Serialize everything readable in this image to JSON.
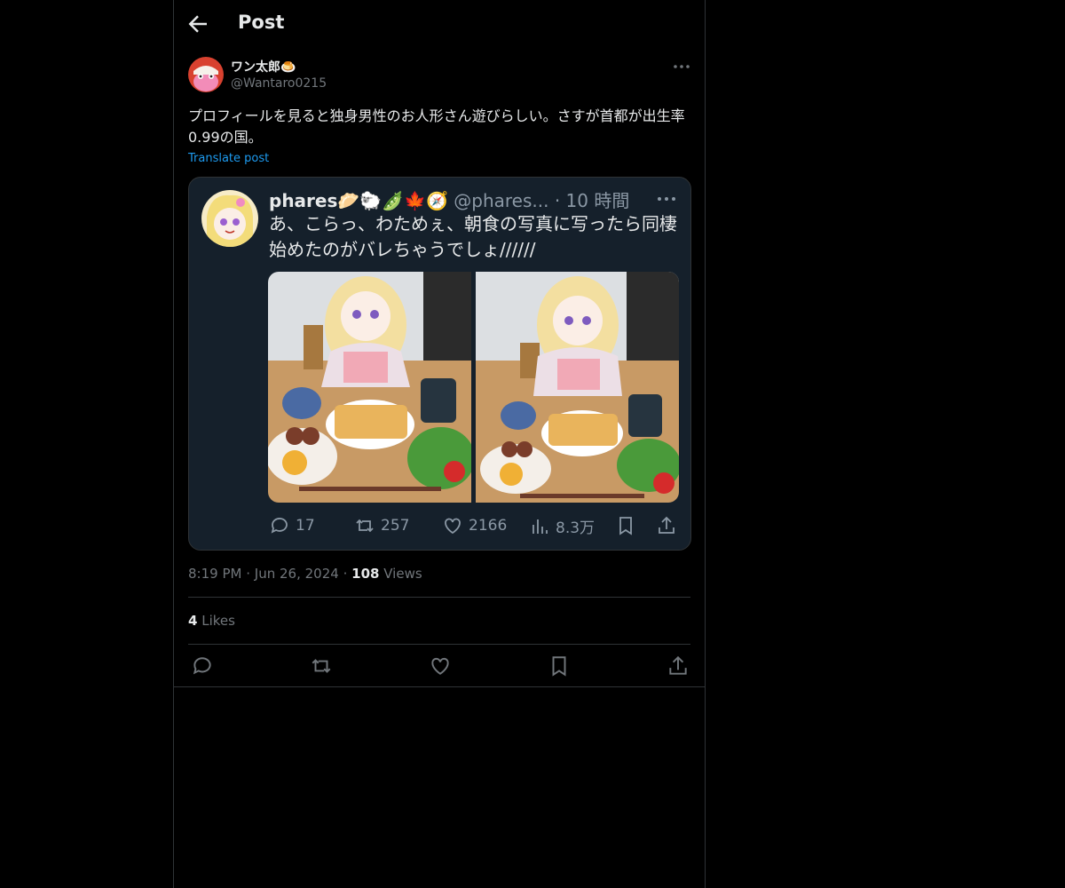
{
  "header": {
    "title": "Post",
    "back_icon": "arrow-left-icon"
  },
  "post": {
    "author_name": "ワン太郎🍮",
    "author_handle": "@Wantaro0215",
    "text": "プロフィールを見ると独身男性のお人形さん遊びらしい。さすが首都が出生率0.99の国。",
    "translate_label": "Translate post",
    "time": "8:19 PM",
    "date": "Jun 26, 2024",
    "separator": "·",
    "views_count": "108",
    "views_label": "Views",
    "likes_count": "4",
    "likes_label": "Likes"
  },
  "quoted": {
    "name": "phares🥟🐑🫛🍁🧭",
    "handle": "@phares...",
    "time": "· 10 時間",
    "text": "あ、こらっ、わためぇ、朝食の写真に写ったら同棲始めたのがバレちゃうでしょ//////",
    "stats": {
      "replies": "17",
      "reposts": "257",
      "likes": "2166",
      "views": "8.3万"
    }
  },
  "actions": [
    "reply-icon",
    "repost-icon",
    "like-icon",
    "bookmark-icon",
    "share-icon"
  ],
  "colors": {
    "background": "#000000",
    "text": "#e7e9ea",
    "muted": "#71767b",
    "link": "#1d9bf0",
    "border": "#2f3336",
    "embed_bg": "#15202b"
  }
}
